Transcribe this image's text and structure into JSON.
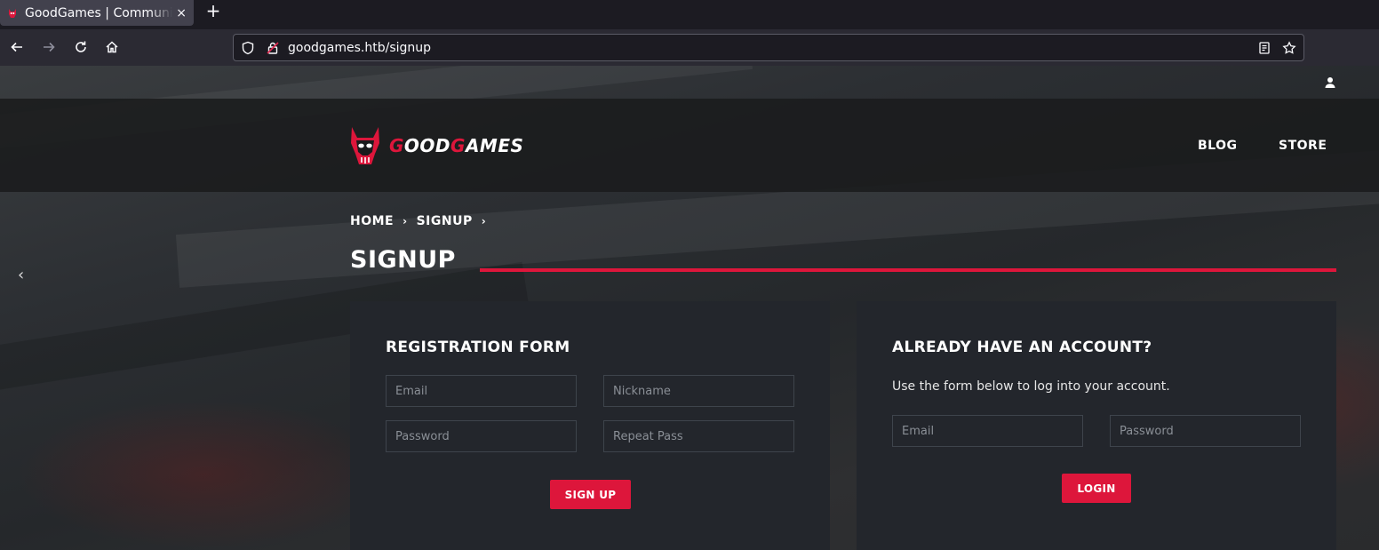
{
  "browser": {
    "tab_title": "GoodGames | Community",
    "tab_close": "×",
    "new_tab": "+",
    "url": "goodgames.htb/signup"
  },
  "site": {
    "logo_text_first": "G",
    "logo_text_rest1": "OOD",
    "logo_text_g2": "G",
    "logo_text_rest2": "AMES",
    "menu": [
      "BLOG",
      "STORE"
    ]
  },
  "breadcrumb": {
    "home": "HOME",
    "current": "SIGNUP",
    "sep": "›"
  },
  "slider_prev": "‹",
  "page_title": "SIGNUP",
  "registration": {
    "heading": "REGISTRATION FORM",
    "email_placeholder": "Email",
    "nickname_placeholder": "Nickname",
    "password_placeholder": "Password",
    "repeat_placeholder": "Repeat Pass",
    "button": "SIGN UP"
  },
  "login": {
    "heading": "ALREADY HAVE AN ACCOUNT?",
    "description": "Use the form below to log into your account.",
    "email_placeholder": "Email",
    "password_placeholder": "Password",
    "button": "LOGIN"
  },
  "colors": {
    "accent": "#dd163b",
    "card_bg": "#23262c",
    "header_bg": "#1a1b1d"
  }
}
